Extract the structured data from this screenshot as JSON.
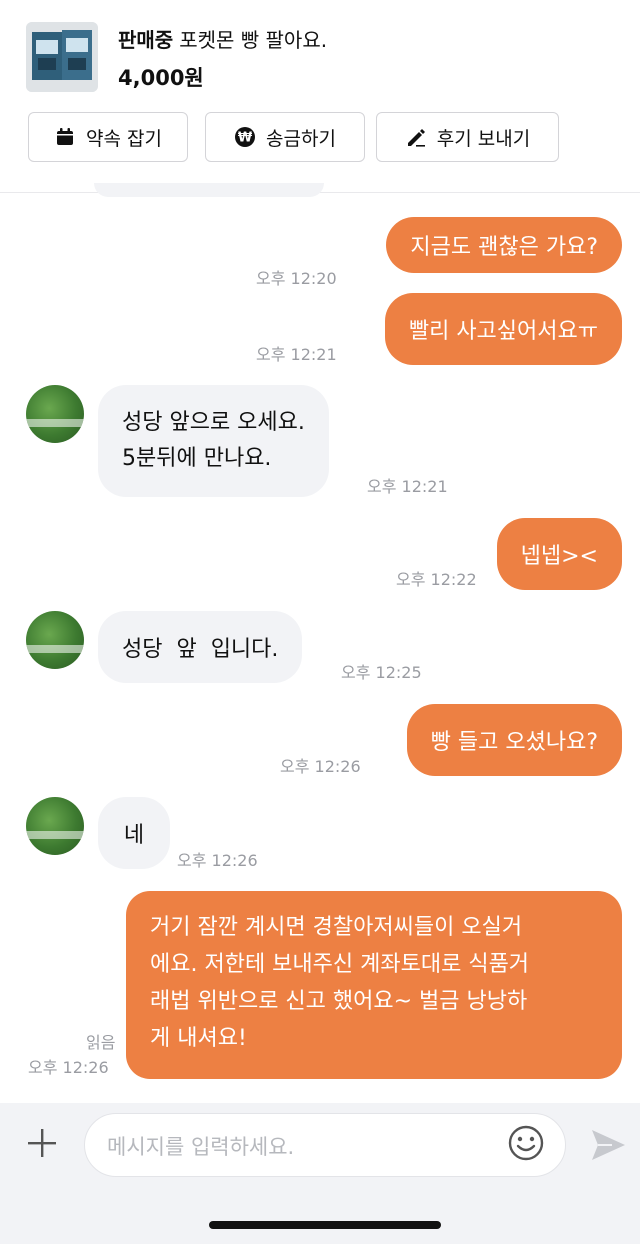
{
  "header": {
    "status": "판매중",
    "product_title": "포켓몬 빵 팔아요.",
    "price": "4,000원",
    "actions": {
      "appointment": "약속 잡기",
      "transfer": "송금하기",
      "review": "후기 보내기"
    }
  },
  "messages": [
    {
      "side": "out",
      "text": "지금도 괜찮은 가요?",
      "time": "오후 12:20"
    },
    {
      "side": "out",
      "text": "빨리 사고싶어서요ㅠ",
      "time": "오후 12:21"
    },
    {
      "side": "in",
      "lines": [
        "성당 앞으로 오세요.",
        "5분뒤에  만나요."
      ],
      "time": "오후 12:21"
    },
    {
      "side": "out",
      "text": "넵넵><",
      "time": "오후 12:22"
    },
    {
      "side": "in",
      "text": "성당  앞  입니다.",
      "time": "오후 12:25"
    },
    {
      "side": "out",
      "text": "빵 들고 오셨나요?",
      "time": "오후 12:26"
    },
    {
      "side": "in",
      "text": "네",
      "time": "오후 12:26"
    },
    {
      "side": "out",
      "lines": [
        "거기 잠깐 계시면 경찰아저씨들이 오실거",
        "에요. 저한테 보내주신 계좌토대로 식품거",
        "래법 위반으로 신고 했어요~ 벌금 낭낭하",
        "게 내셔요!"
      ],
      "time": "오후 12:26",
      "read": "읽음"
    }
  ],
  "input": {
    "placeholder": "메시지를 입력하세요."
  },
  "colors": {
    "outgoing_bubble": "#ed8043",
    "incoming_bubble": "#f2f3f6",
    "timestamp": "#9a9ca2"
  },
  "icons": [
    "calendar-icon",
    "won-icon",
    "pencil-icon",
    "plus-icon",
    "emoji-icon",
    "send-icon"
  ]
}
